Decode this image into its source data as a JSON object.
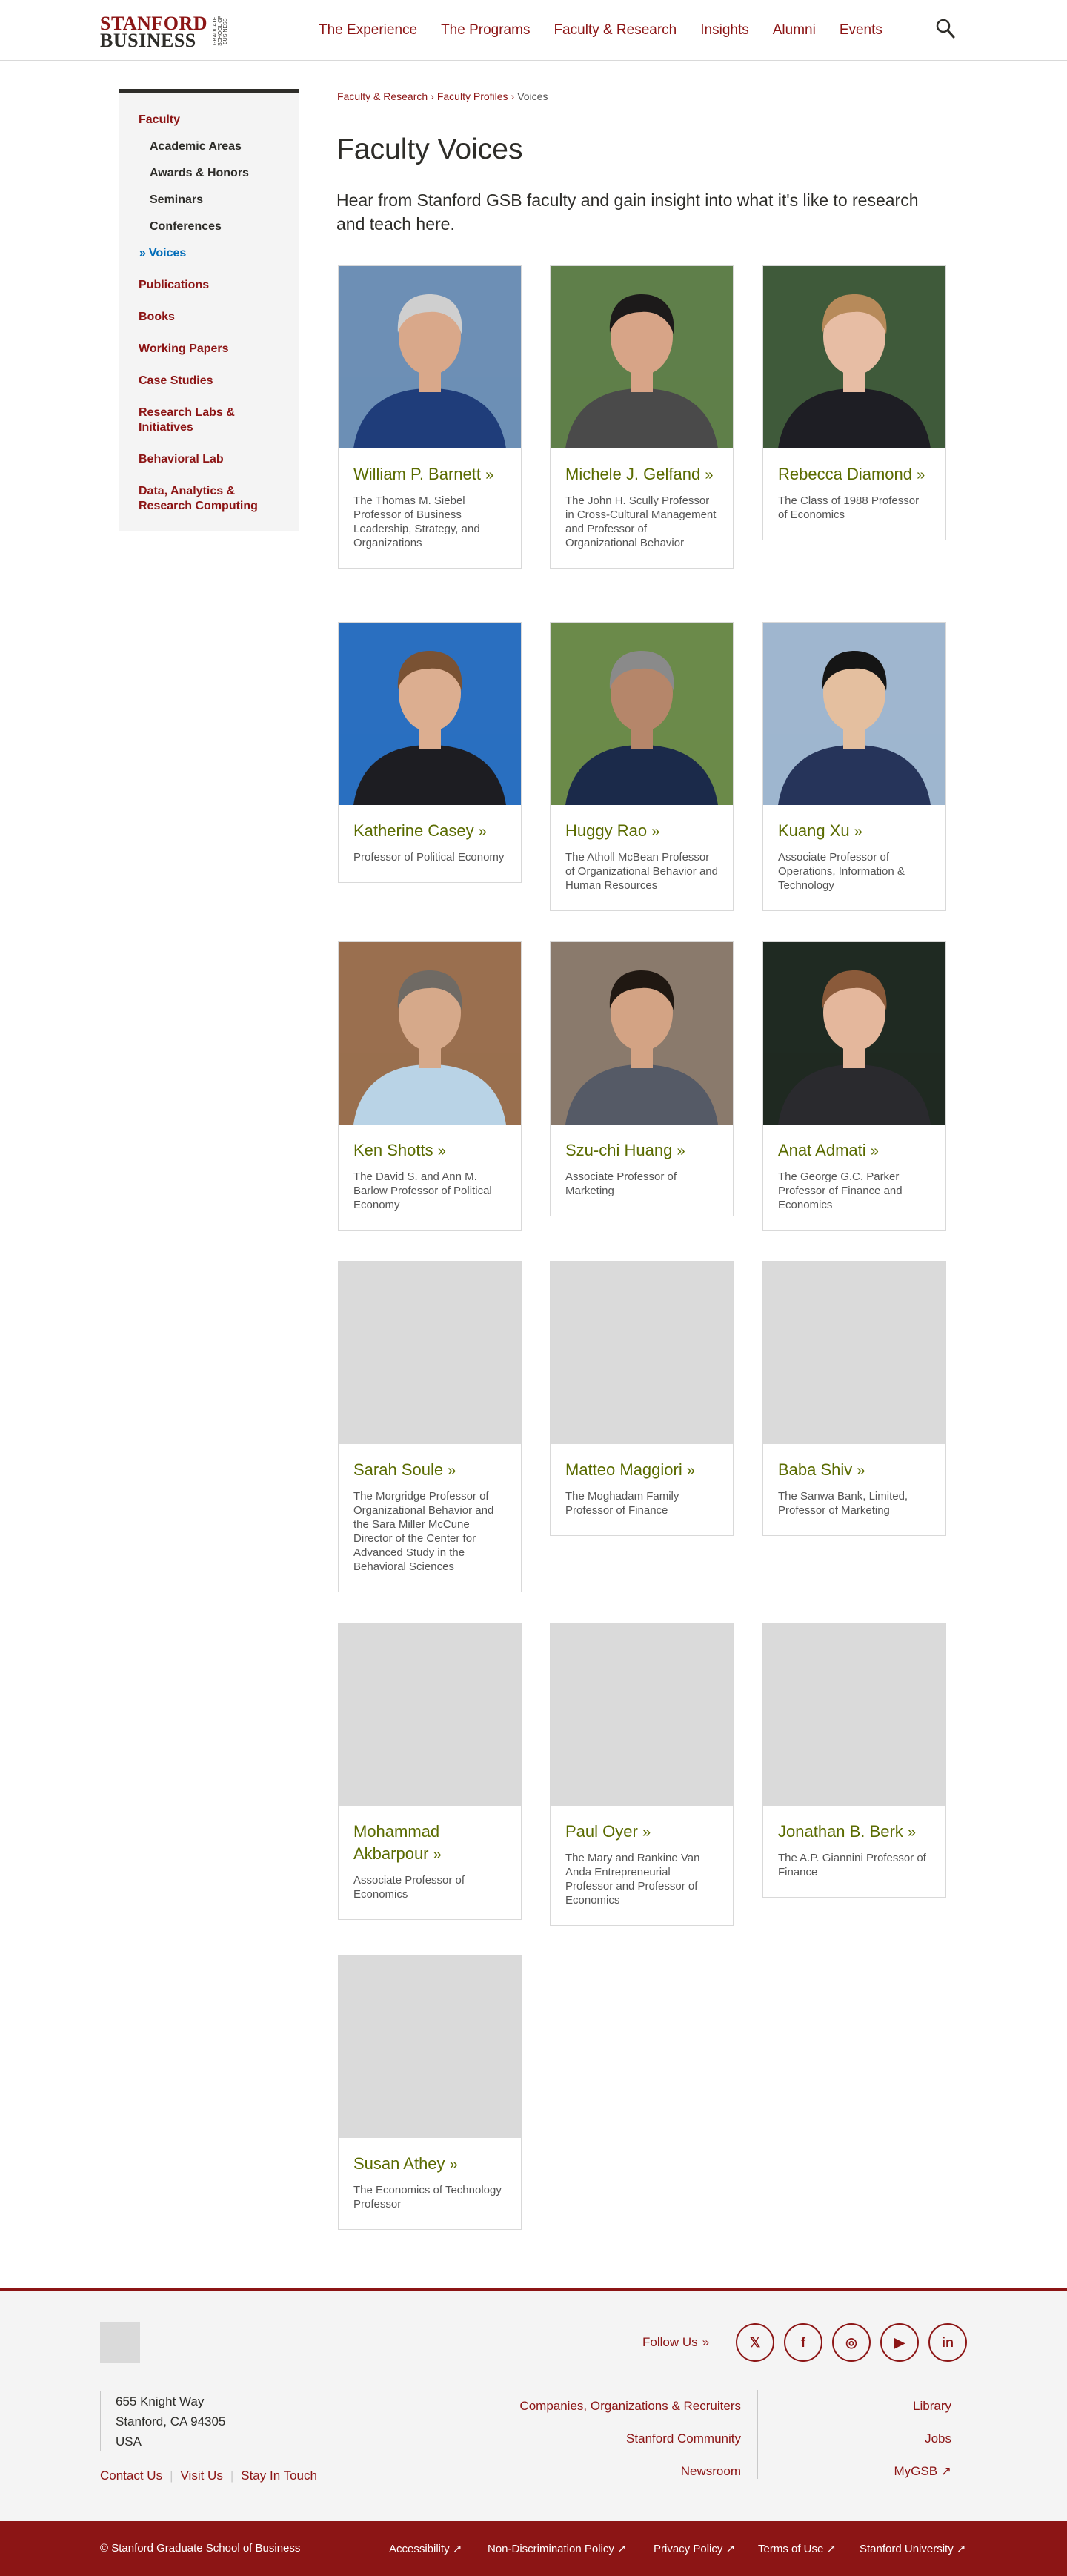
{
  "brand": {
    "logo_line1": "STANFORD",
    "logo_line2": "BUSINESS",
    "logo_vertical": "GRADUATE SCHOOL OF BUSINESS",
    "accent_color": "#8c1515",
    "name_color": "#5a6b00"
  },
  "nav": {
    "items": [
      "The Experience",
      "The Programs",
      "Faculty & Research",
      "Insights",
      "Alumni",
      "Events"
    ],
    "search_icon": "search-icon"
  },
  "sidebar": {
    "items": [
      {
        "label": "Faculty",
        "level": "top"
      },
      {
        "label": "Academic Areas",
        "level": "sub"
      },
      {
        "label": "Awards & Honors",
        "level": "sub"
      },
      {
        "label": "Seminars",
        "level": "sub"
      },
      {
        "label": "Conferences",
        "level": "sub"
      },
      {
        "label": "Voices",
        "level": "active"
      },
      {
        "label": "Publications",
        "level": "top"
      },
      {
        "label": "Books",
        "level": "top"
      },
      {
        "label": "Working Papers",
        "level": "top"
      },
      {
        "label": "Case Studies",
        "level": "top"
      },
      {
        "label": "Research Labs & Initiatives",
        "level": "top"
      },
      {
        "label": "Behavioral Lab",
        "level": "top"
      },
      {
        "label": "Data, Analytics & Research Computing",
        "level": "top"
      }
    ]
  },
  "breadcrumb": {
    "items": [
      "Faculty & Research",
      "Faculty Profiles",
      "Voices"
    ]
  },
  "page": {
    "title": "Faculty Voices",
    "intro": "Hear from Stanford GSB faculty and gain insight into what it's like to research and teach here."
  },
  "faculty": [
    {
      "name": "William P. Barnett",
      "title": "The Thomas M. Siebel Professor of Business Leadership, Strategy, and Organizations",
      "photo": "portrait",
      "bg": "#6d8fb5",
      "shirt": "#1f3d7a",
      "skin": "#d9a88a",
      "hair": "#cfcfcf"
    },
    {
      "name": "Michele J. Gelfand",
      "title": "The John H. Scully Professor in Cross-Cultural Management and Professor of Organizational Behavior",
      "photo": "portrait",
      "bg": "#5f7f4a",
      "shirt": "#4a4a4a",
      "skin": "#d7a487",
      "hair": "#1c1a1a"
    },
    {
      "name": "Rebecca Diamond",
      "title": "The Class of 1988 Professor of Economics",
      "photo": "portrait",
      "bg": "#3f5a3a",
      "shirt": "#1e1e24",
      "skin": "#e7bda4",
      "hair": "#b78a5a"
    },
    {
      "name": "Katherine Casey",
      "title": "Professor of Political Economy",
      "photo": "portrait",
      "bg": "#2a6fc0",
      "shirt": "#1d1d22",
      "skin": "#dcae90",
      "hair": "#7a5233"
    },
    {
      "name": "Huggy Rao",
      "title": "The Atholl McBean Professor of Organizational Behavior and Human Resources",
      "photo": "portrait",
      "bg": "#6b8a4a",
      "shirt": "#1b2a4a",
      "skin": "#b5866a",
      "hair": "#8a8a8a"
    },
    {
      "name": "Kuang Xu",
      "title": "Associate Professor of Operations, Information & Technology",
      "photo": "portrait",
      "bg": "#9fb6cf",
      "shirt": "#26345a",
      "skin": "#e4bf9f",
      "hair": "#151515"
    },
    {
      "name": "Ken Shotts",
      "title": "The David S. and Ann M. Barlow Professor of Political Economy",
      "photo": "portrait",
      "bg": "#9a6f4f",
      "shirt": "#b9d3e6",
      "skin": "#d6a98a",
      "hair": "#6f6a64"
    },
    {
      "name": "Szu-chi Huang",
      "title": "Associate Professor of Marketing",
      "photo": "portrait",
      "bg": "#8a7a6c",
      "shirt": "#555a66",
      "skin": "#d3a384",
      "hair": "#201812"
    },
    {
      "name": "Anat Admati",
      "title": "The George G.C. Parker Professor of Finance and Economics",
      "photo": "portrait",
      "bg": "#1f2a22",
      "shirt": "#2a2a2e",
      "skin": "#e4b79c",
      "hair": "#8a5a3a"
    },
    {
      "name": "Sarah Soule",
      "title": "The Morgridge Professor of Organizational Behavior and the Sara Miller McCune Director of the Center for Advanced Study in the Behavioral Sciences",
      "photo": "blank"
    },
    {
      "name": "Matteo Maggiori",
      "title": "The Moghadam Family Professor of Finance",
      "photo": "blank"
    },
    {
      "name": "Baba Shiv",
      "title": "The Sanwa Bank, Limited, Professor of Marketing",
      "photo": "blank"
    },
    {
      "name": "Mohammad Akbarpour",
      "title": "Associate Professor of Economics",
      "photo": "blank"
    },
    {
      "name": "Paul Oyer",
      "title": "The Mary and Rankine Van Anda Entrepreneurial Professor and Professor of Economics",
      "photo": "blank"
    },
    {
      "name": "Jonathan B. Berk",
      "title": "The A.P. Giannini Professor of Finance",
      "photo": "blank"
    },
    {
      "name": "Susan Athey",
      "title": "The Economics of Technology Professor",
      "photo": "blank"
    }
  ],
  "footer": {
    "follow_label": "Follow Us",
    "social": [
      {
        "name": "twitter-icon",
        "glyph": "𝕏"
      },
      {
        "name": "facebook-icon",
        "glyph": "f"
      },
      {
        "name": "instagram-icon",
        "glyph": "◎"
      },
      {
        "name": "youtube-icon",
        "glyph": "▶"
      },
      {
        "name": "linkedin-icon",
        "glyph": "in"
      }
    ],
    "address": [
      "655 Knight Way",
      "Stanford, CA 94305",
      "USA"
    ],
    "links": [
      "Contact Us",
      "Visit Us",
      "Stay In Touch"
    ],
    "col1": [
      "Companies, Organizations & Recruiters",
      "Stanford Community",
      "Newsroom"
    ],
    "col2": [
      "Library",
      "Jobs",
      "MyGSB ↗"
    ]
  },
  "bottom": {
    "copyright": "© Stanford Graduate School of Business",
    "legal": [
      "Accessibility ↗",
      "Non-Discrimination Policy ↗",
      "Privacy Policy ↗",
      "Terms of Use ↗",
      "Stanford University ↗"
    ]
  }
}
